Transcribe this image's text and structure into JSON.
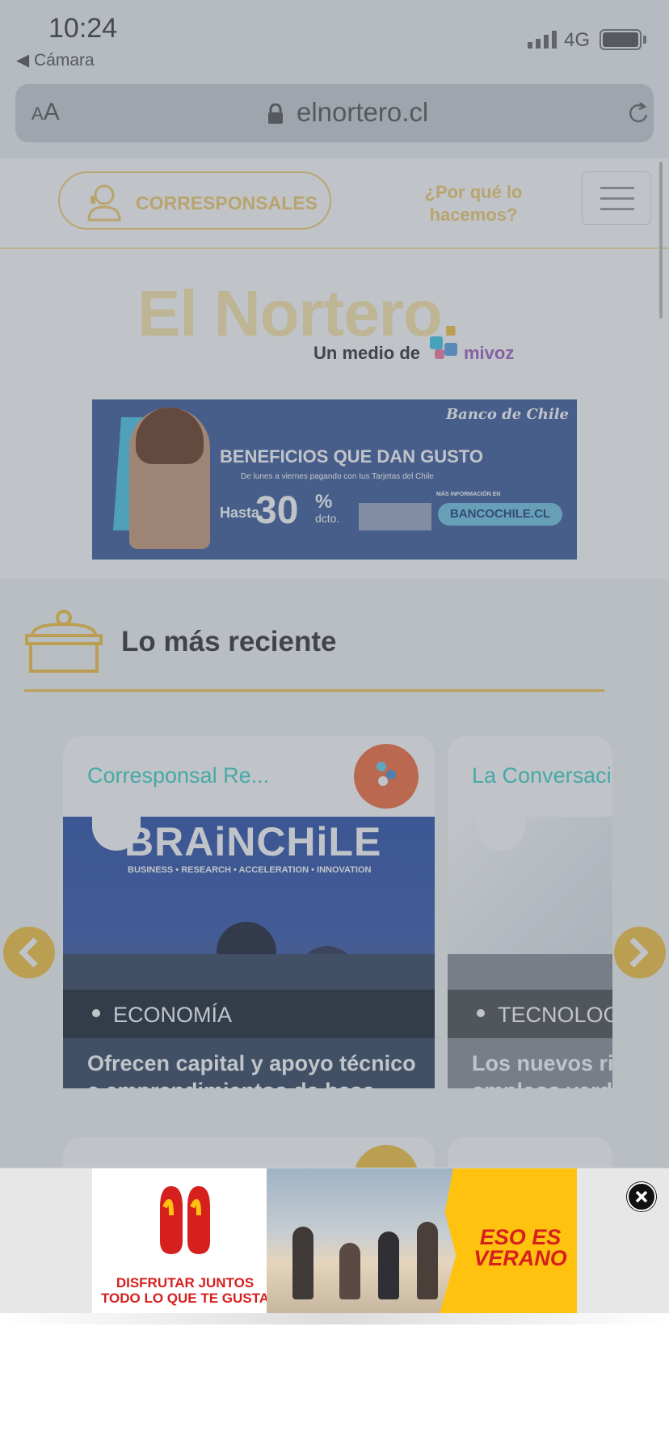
{
  "status_bar": {
    "time": "10:24",
    "back_label": "◀ Cámara",
    "network": "4G"
  },
  "browser": {
    "text_size_small": "A",
    "text_size_large": "A",
    "domain": "elnortero.cl"
  },
  "header": {
    "corresponsales_label": "CORRESPONSALES",
    "why_label": "¿Por qué lo hacemos?",
    "logo_text": "El Nortero",
    "logo_dot": ".",
    "tagline": "Un medio de",
    "partner_name": "mivoz"
  },
  "bank_ad": {
    "brand": "Banco de Chile",
    "headline": "BENEFICIOS QUE DAN GUSTO",
    "subline": "De lunes a viernes pagando con tus Tarjetas del Chile",
    "hasta": "Hasta",
    "percent": "30",
    "percent_symbol": "%",
    "percent_suffix": "dcto.",
    "more_info": "MÁS INFORMACIÓN EN",
    "url": "BANCOCHILE.CL"
  },
  "recent": {
    "title": "Lo más reciente",
    "cards": [
      {
        "author": "Corresponsal Re...",
        "image_text": "BRAiNCHiLE",
        "image_subtext": "BUSINESS • RESEARCH • ACCELERATION • INNOVATION",
        "category": "ECONOMÍA",
        "title": "Ofrecen capital y apoyo técnico a emprendimientos de base científico-tecnológica"
      },
      {
        "author": "La Conversaci",
        "category": "TECNOLOG",
        "title_line1": "Los nuevos rie",
        "title_line2": "empleos verde"
      }
    ]
  },
  "bottom_ad": {
    "tagline_line1": "DISFRUTAR JUNTOS",
    "tagline_line2": "TODO LO QUE TE GUSTA",
    "slogan_line1": "ESO ES",
    "slogan_line2": "VERANO"
  },
  "colors": {
    "accent_yellow": "#f6c342",
    "author_teal": "#3cd3c7",
    "bank_blue": "#3d5a9a",
    "mcdonalds_red": "#d6201e",
    "mcdonalds_yellow": "#ffc20f"
  }
}
